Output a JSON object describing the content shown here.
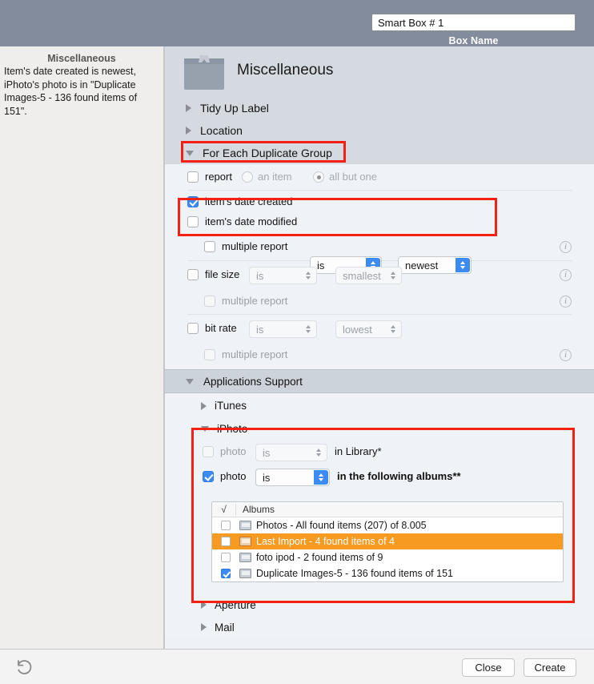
{
  "window": {
    "box_name_value": "Smart Box # 1",
    "box_name_placeholder": "Box Name",
    "box_name_caption": "Box Name"
  },
  "sidebar": {
    "title": "Miscellaneous",
    "description": "Item's date created is newest, iPhoto's photo is in \"Duplicate Images-5 - 136 found items of 151\"."
  },
  "header": {
    "title": "Miscellaneous",
    "icon": "box-icon"
  },
  "sections": [
    {
      "label": "Tidy Up Label",
      "expanded": false
    },
    {
      "label": "Location",
      "expanded": false
    },
    {
      "label": "For Each Duplicate Group",
      "expanded": true
    }
  ],
  "duplicate_group": {
    "report": {
      "label": "report",
      "checked": false
    },
    "an_item": {
      "label": "an item",
      "selected": false
    },
    "all_but_one": {
      "label": "all but one",
      "selected": true
    },
    "rules": [
      {
        "name": "date-created",
        "label": "item's date created",
        "checked": true,
        "enabled": true,
        "operator": "is",
        "value": "newest"
      },
      {
        "name": "date-modified",
        "label": "item's date modified",
        "checked": false,
        "enabled": true
      },
      {
        "name": "date-multiple-report",
        "label": "multiple report",
        "checked": false,
        "enabled": true,
        "info": "i"
      },
      {
        "name": "file-size",
        "label": "file size",
        "checked": false,
        "enabled": false,
        "operator": "is",
        "value": "smallest",
        "info": "i"
      },
      {
        "name": "file-size-multiple-report",
        "label": "multiple report",
        "checked": false,
        "enabled": false,
        "info": "i"
      },
      {
        "name": "bit-rate",
        "label": "bit rate",
        "checked": false,
        "enabled": false,
        "operator": "is",
        "value": "lowest",
        "info": "i"
      },
      {
        "name": "bit-rate-multiple-report",
        "label": "multiple report",
        "checked": false,
        "enabled": false,
        "info": "i"
      }
    ]
  },
  "applications_support": {
    "label": "Applications Support",
    "expanded": true,
    "apps": [
      {
        "label": "iTunes",
        "expanded": false
      },
      {
        "label": "iPhoto",
        "expanded": true
      },
      {
        "label": "Aperture",
        "expanded": false
      },
      {
        "label": "Mail",
        "expanded": false
      }
    ],
    "iphoto": {
      "row_library": {
        "label": "photo",
        "checked": false,
        "enabled": false,
        "operator": "is",
        "suffix": "in Library*"
      },
      "row_albums": {
        "label": "photo",
        "checked": true,
        "enabled": true,
        "operator": "is",
        "suffix": "in the following albums**"
      },
      "albums_table": {
        "col_check": "√",
        "col_name": "Albums",
        "rows": [
          {
            "checked": false,
            "selected": false,
            "name": "Photos - All found items (207) of 8.005"
          },
          {
            "checked": false,
            "selected": true,
            "name": "Last Import - 4 found items of 4"
          },
          {
            "checked": false,
            "selected": false,
            "name": "foto ipod - 2 found items of 9"
          },
          {
            "checked": true,
            "selected": false,
            "name": "Duplicate Images-5 - 136 found items of 151"
          }
        ]
      }
    }
  },
  "footer": {
    "undo_icon": "undo-arrow-icon",
    "close_label": "Close",
    "create_label": "Create"
  },
  "colors": {
    "accent_blue": "#3d8bf2",
    "selection_orange": "#f79a21",
    "titlebar": "#828c9c",
    "highlight_red": "#f42113"
  }
}
